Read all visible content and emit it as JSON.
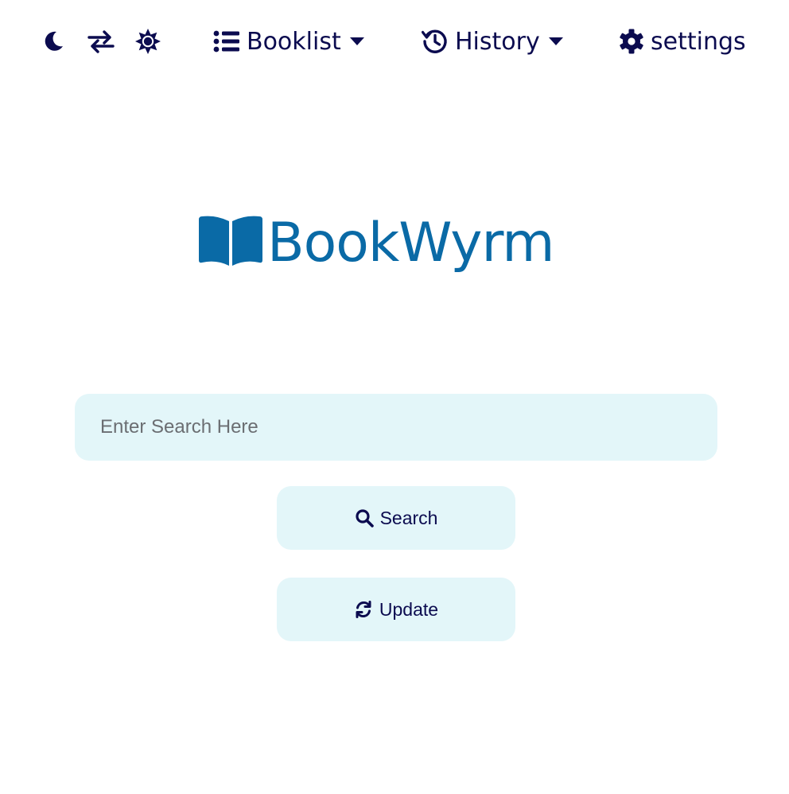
{
  "colors": {
    "nav_text": "#0b0b4f",
    "brand": "#0a6aa6",
    "field_background": "#e3f6f9",
    "background": "#ffffff"
  },
  "navbar": {
    "icons": [
      {
        "name": "moon-icon",
        "meaning": "dark mode"
      },
      {
        "name": "swap-icon",
        "meaning": "switch"
      },
      {
        "name": "sun-icon",
        "meaning": "light mode"
      }
    ],
    "booklist": {
      "label": "Booklist",
      "icon": "list-icon"
    },
    "history": {
      "label": "History",
      "icon": "history-icon"
    },
    "settings": {
      "label": "settings",
      "icon": "gear-icon"
    }
  },
  "brand": {
    "logo_text": "BookWyrm",
    "logo_icon": "open-book-icon"
  },
  "search": {
    "placeholder": "Enter Search Here",
    "value": ""
  },
  "buttons": {
    "search_label": "Search",
    "update_label": "Update"
  }
}
